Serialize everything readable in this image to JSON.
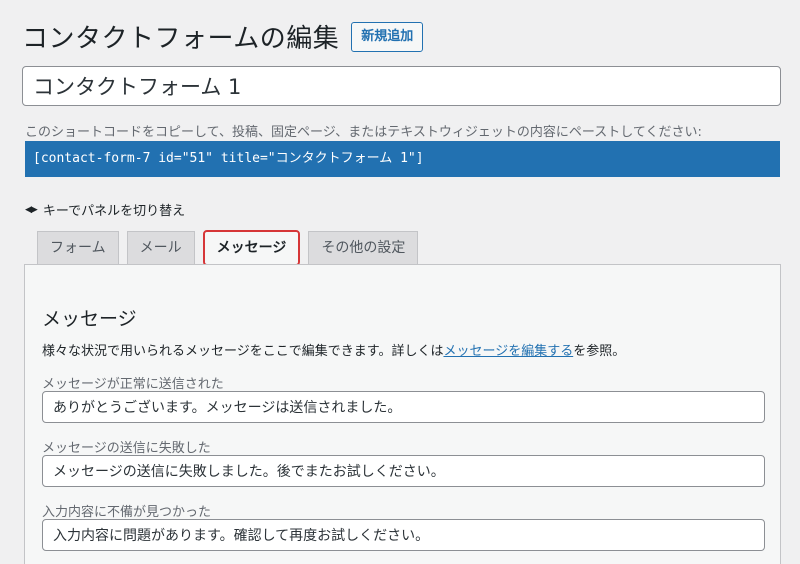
{
  "header": {
    "title": "コンタクトフォームの編集",
    "add_new_label": "新規追加"
  },
  "form_title": {
    "value": "コンタクトフォーム 1"
  },
  "shortcode": {
    "hint": "このショートコードをコピーして、投稿、固定ページ、またはテキストウィジェットの内容にペーストしてください:",
    "code": "[contact-form-7 id=\"51\" title=\"コンタクトフォーム 1\"]"
  },
  "keyboard_hint": {
    "icon": "left-right-arrows-icon",
    "text": "キーでパネルを切り替え"
  },
  "tabs": [
    {
      "label": "フォーム",
      "active": false
    },
    {
      "label": "メール",
      "active": false
    },
    {
      "label": "メッセージ",
      "active": true
    },
    {
      "label": "その他の設定",
      "active": false
    }
  ],
  "panel": {
    "title": "メッセージ",
    "desc_before": "様々な状況で用いられるメッセージをここで編集できます。詳しくは",
    "desc_link": "メッセージを編集する",
    "desc_after": "を参照。",
    "fields": [
      {
        "label": "メッセージが正常に送信された",
        "value": "ありがとうございます。メッセージは送信されました。"
      },
      {
        "label": "メッセージの送信に失敗した",
        "value": "メッセージの送信に失敗しました。後でまたお試しください。"
      },
      {
        "label": "入力内容に不備が見つかった",
        "value": "入力内容に問題があります。確認して再度お試しください。"
      }
    ]
  },
  "colors": {
    "accent": "#2271b1",
    "active_tab_highlight": "#d63638",
    "background": "#f0f0f1"
  }
}
